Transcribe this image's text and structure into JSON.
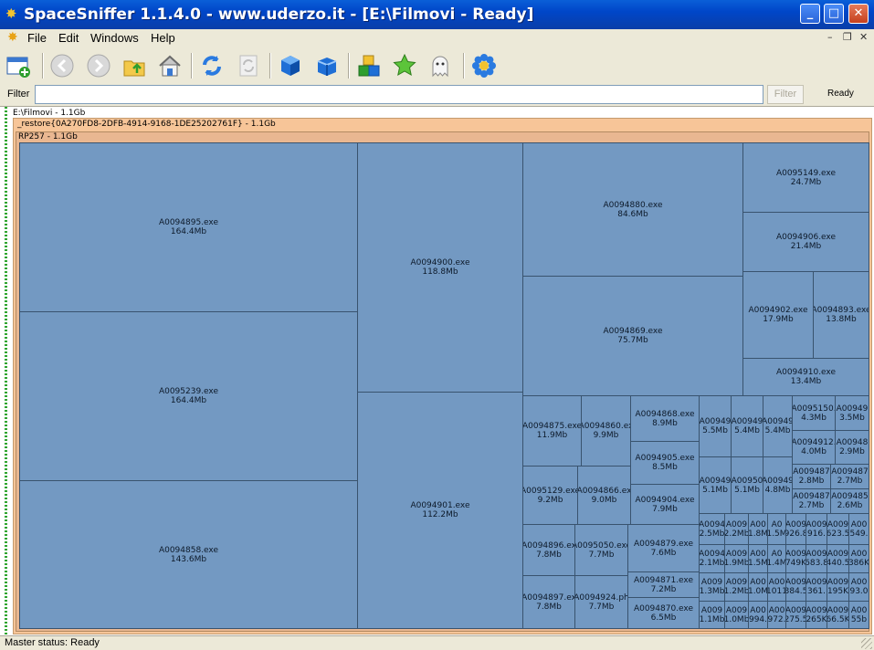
{
  "window": {
    "title": "SpaceSniffer 1.1.4.0 - www.uderzo.it - [E:\\Filmovi - Ready]",
    "app_icon": "spacesniffer-star-icon",
    "controls": [
      "_",
      "□",
      "✕"
    ]
  },
  "menu": {
    "items": [
      "File",
      "Edit",
      "Windows",
      "Help"
    ],
    "mdi_controls": [
      "–",
      "❐",
      "✕"
    ]
  },
  "toolbar": {
    "icons": [
      "new-scan-icon",
      "back-icon",
      "forward-icon",
      "up-folder-icon",
      "home-icon",
      "refresh-icon",
      "refresh-disabled-icon",
      "blue-cube-icon",
      "blue-cube-open-icon",
      "blocks-icon",
      "star-icon",
      "ghost-icon",
      "settings-flower-icon"
    ]
  },
  "filter": {
    "label": "Filter",
    "value": "",
    "button": "Filter",
    "state": "Ready"
  },
  "path": {
    "root": "E:\\Filmovi - 1.1Gb",
    "restore": "_restore{0A270FD8-2DFB-4914-9168-1DE25202761F} - 1.1Gb",
    "rp": "RP257 - 1.1Gb"
  },
  "tiles": [
    {
      "name": "A0094895.exe",
      "size": "164.4Mb"
    },
    {
      "name": "A0095239.exe",
      "size": "164.4Mb"
    },
    {
      "name": "A0094858.exe",
      "size": "143.6Mb"
    },
    {
      "name": "A0094900.exe",
      "size": "118.8Mb"
    },
    {
      "name": "A0094901.exe",
      "size": "112.2Mb"
    },
    {
      "name": "A0094880.exe",
      "size": "84.6Mb"
    },
    {
      "name": "A0094869.exe",
      "size": "75.7Mb"
    },
    {
      "name": "A0095149.exe",
      "size": "24.7Mb"
    },
    {
      "name": "A0094906.exe",
      "size": "21.4Mb"
    },
    {
      "name": "A0094902.exe",
      "size": "17.9Mb"
    },
    {
      "name": "A0094893.exe",
      "size": "13.8Mb"
    },
    {
      "name": "A0094910.exe",
      "size": "13.4Mb"
    },
    {
      "name": "A0094875.exe",
      "size": "11.9Mb"
    },
    {
      "name": "A0094860.ex",
      "size": "9.9Mb"
    },
    {
      "name": "A0094868.exe",
      "size": "8.9Mb"
    },
    {
      "name": "A0094905.exe",
      "size": "8.5Mb"
    },
    {
      "name": "A0094904.exe",
      "size": "7.9Mb"
    },
    {
      "name": "A0095129.exe",
      "size": "9.2Mb"
    },
    {
      "name": "A0094866.ex",
      "size": "9.0Mb"
    },
    {
      "name": "A0094896.ex",
      "size": "7.8Mb"
    },
    {
      "name": "A0095050.exe",
      "size": "7.7Mb"
    },
    {
      "name": "A0094897.ex",
      "size": "7.8Mb"
    },
    {
      "name": "A0094924.ph",
      "size": "7.7Mb"
    },
    {
      "name": "A0094879.exe",
      "size": "7.6Mb"
    },
    {
      "name": "A0094871.exe",
      "size": "7.2Mb"
    },
    {
      "name": "A0094870.exe",
      "size": "6.5Mb"
    },
    {
      "name": "A00949",
      "size": "5.5Mb"
    },
    {
      "name": "A00949",
      "size": "5.4Mb"
    },
    {
      "name": "A00949",
      "size": "5.4Mb"
    },
    {
      "name": "A00949",
      "size": "5.1Mb"
    },
    {
      "name": "A00950",
      "size": "5.1Mb"
    },
    {
      "name": "A00949",
      "size": "4.8Mb"
    },
    {
      "name": "A0095150.",
      "size": "4.3Mb"
    },
    {
      "name": "A00949",
      "size": "3.5Mb"
    },
    {
      "name": "A0094912.",
      "size": "4.0Mb"
    },
    {
      "name": "A00948",
      "size": "2.9Mb"
    },
    {
      "name": "A009487",
      "size": "2.8Mb"
    },
    {
      "name": "A009487",
      "size": "2.7Mb"
    },
    {
      "name": "A009487",
      "size": "2.7Mb"
    },
    {
      "name": "A009485",
      "size": "2.6Mb"
    },
    {
      "name": "A0094",
      "size": "2.5Mb"
    },
    {
      "name": "A009",
      "size": "2.2Mb"
    },
    {
      "name": "A00",
      "size": "1.8M"
    },
    {
      "name": "A0",
      "size": "1.5M"
    },
    {
      "name": "A009",
      "size": "926.8"
    },
    {
      "name": "A009",
      "size": "916."
    },
    {
      "name": "A009",
      "size": "623.5"
    },
    {
      "name": "A00",
      "size": "549."
    },
    {
      "name": "A0094",
      "size": "2.1Mb"
    },
    {
      "name": "A009",
      "size": "1.9Mb"
    },
    {
      "name": "A00",
      "size": "1.5M"
    },
    {
      "name": "A0",
      "size": "1.4M"
    },
    {
      "name": "A009",
      "size": "749K"
    },
    {
      "name": "A009",
      "size": "683.8"
    },
    {
      "name": "A009",
      "size": "440.5"
    },
    {
      "name": "A00",
      "size": "386K"
    },
    {
      "name": "A009",
      "size": "1.3Mb"
    },
    {
      "name": "A009",
      "size": "1.2Mb"
    },
    {
      "name": "A00",
      "size": "1.0M"
    },
    {
      "name": "A00",
      "size": "1011"
    },
    {
      "name": "A009",
      "size": "384.5"
    },
    {
      "name": "A009",
      "size": "361."
    },
    {
      "name": "A009",
      "size": "195K"
    },
    {
      "name": "A00",
      "size": "93.0"
    },
    {
      "name": "A009",
      "size": "1.1Mb"
    },
    {
      "name": "A009",
      "size": "1.0Mb"
    },
    {
      "name": "A00",
      "size": "994."
    },
    {
      "name": "A00",
      "size": "972."
    },
    {
      "name": "A009",
      "size": "275.5"
    },
    {
      "name": "A009",
      "size": "265K"
    },
    {
      "name": "A009",
      "size": "66.5K"
    },
    {
      "name": "A00",
      "size": "55b"
    }
  ],
  "status": {
    "text": "Master status: Ready"
  }
}
